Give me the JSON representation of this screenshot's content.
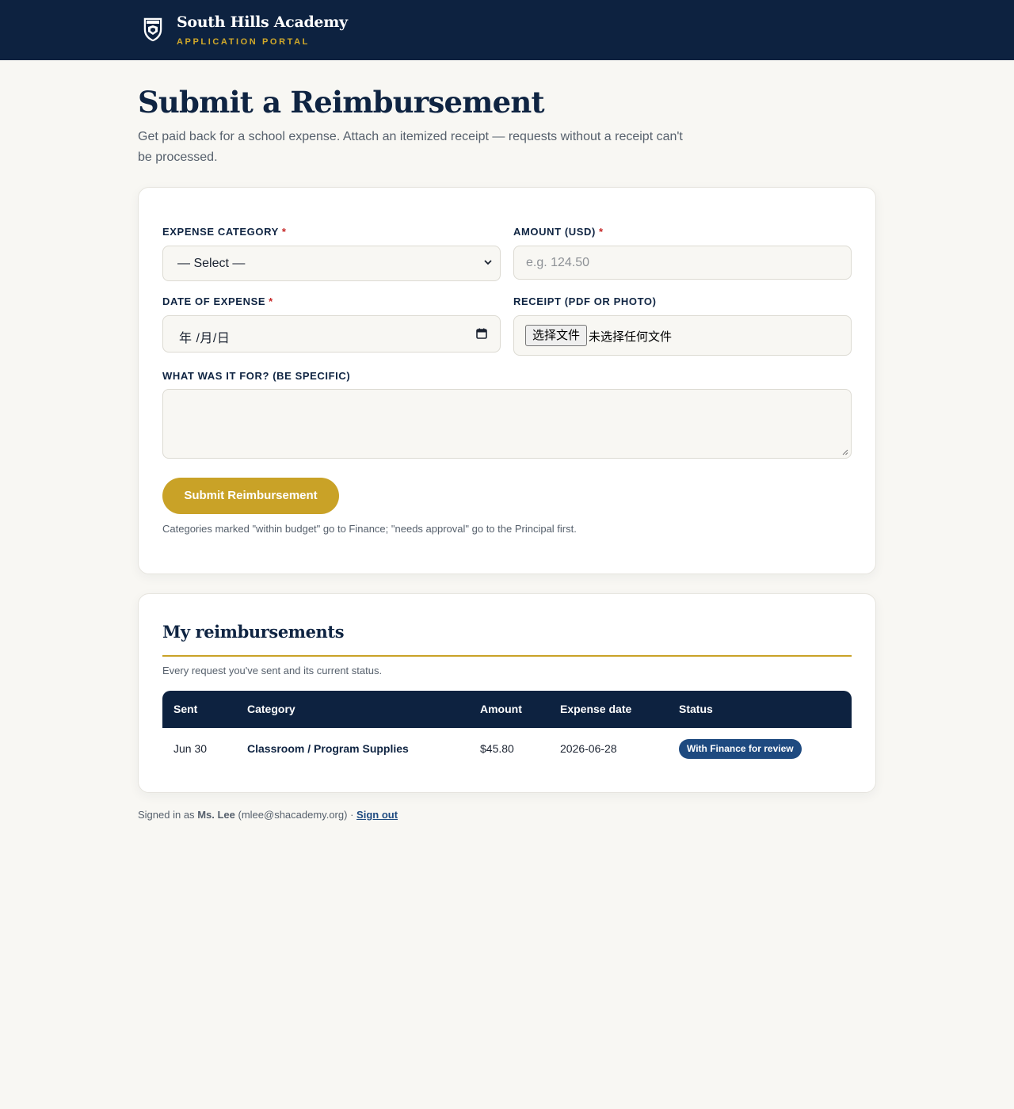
{
  "header": {
    "school_name": "South Hills Academy",
    "portal_label": "APPLICATION PORTAL"
  },
  "page": {
    "title": "Submit a Reimbursement",
    "lead": "Get paid back for a school expense. Attach an itemized receipt — requests without a receipt can't be processed."
  },
  "form": {
    "category_label": "EXPENSE CATEGORY",
    "category_value": "— Select —",
    "amount_label": "AMOUNT (USD)",
    "amount_placeholder": "e.g. 124.50",
    "date_label": "DATE OF EXPENSE",
    "date_value": "年 /月/日",
    "receipt_label": "RECEIPT (PDF OR PHOTO)",
    "file_button": "选择文件",
    "file_status": "未选择任何文件",
    "purpose_label": "WHAT WAS IT FOR? (BE SPECIFIC)",
    "purpose_value": "",
    "required_mark": "*",
    "submit_label": "Submit Reimbursement",
    "note": "Categories marked \"within budget\" go to Finance; \"needs approval\" go to the Principal first."
  },
  "reimbursements": {
    "title": "My reimbursements",
    "subtitle": "Every request you've sent and its current status.",
    "columns": [
      "Sent",
      "Category",
      "Amount",
      "Expense date",
      "Status"
    ],
    "rows": [
      {
        "sent": "Jun 30",
        "category": "Classroom / Program Supplies",
        "amount": "$45.80",
        "expense_date": "2026-06-28",
        "status": "With Finance for review"
      }
    ]
  },
  "footer": {
    "prefix": "Signed in as",
    "user_name": "Ms. Lee",
    "email": "(mlee@shacademy.org)",
    "separator": "·",
    "sign_out": "Sign out"
  },
  "colors": {
    "navy": "#0d2240",
    "gold": "#c9a227",
    "status_blue": "#1e4a80",
    "required_red": "#c62828"
  },
  "icons": [
    "school-crest-icon",
    "chevron-down-icon",
    "calendar-icon",
    "resize-handle-icon"
  ]
}
